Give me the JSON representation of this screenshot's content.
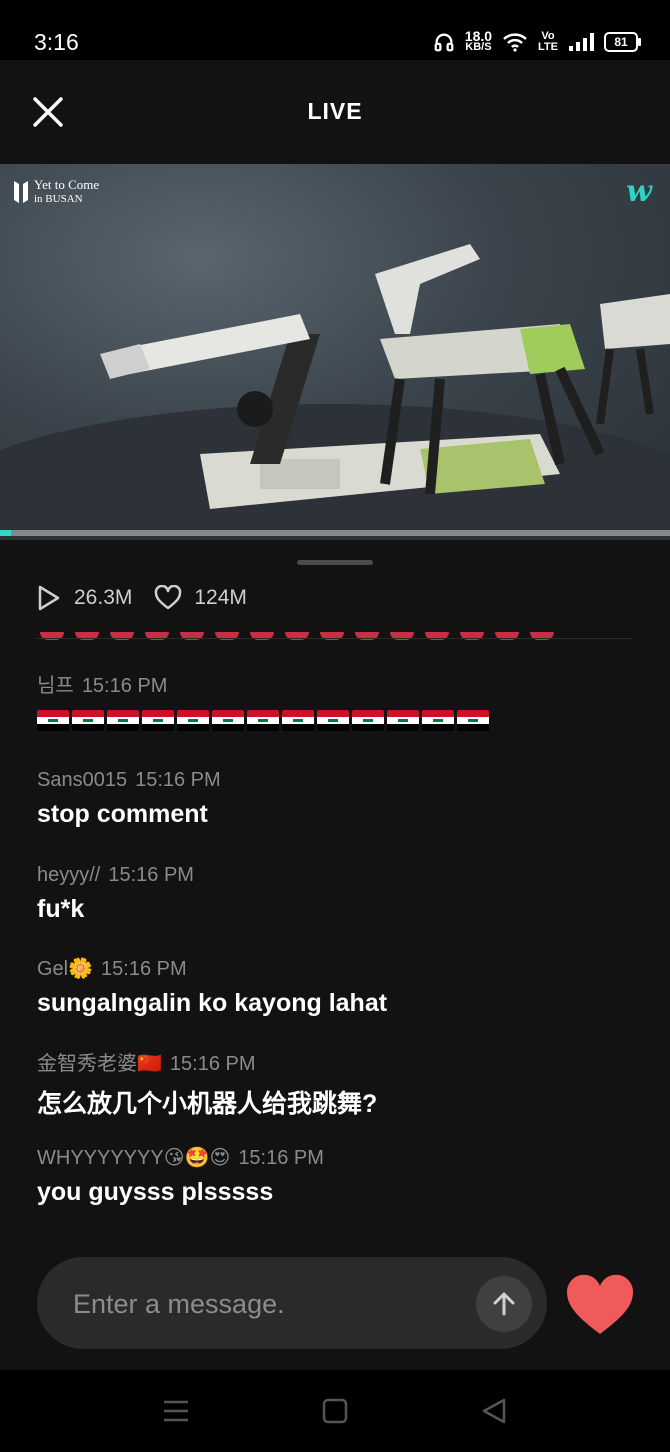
{
  "status_bar": {
    "time": "3:16",
    "net_speed_value": "18.0",
    "net_speed_unit": "KB/S",
    "network_label_top": "Vo",
    "network_label_bottom": "LTE",
    "battery": "81"
  },
  "header": {
    "title": "LIVE"
  },
  "video": {
    "logo_line1": "Yet to Come",
    "logo_line2": "in BUSAN",
    "brand_icon": "w",
    "progress_fraction": 0.017
  },
  "stats": {
    "views": "26.3M",
    "likes": "124M"
  },
  "chat": [
    {
      "user": "님프",
      "time": "15:16 PM",
      "text": "",
      "flag_count": 13
    },
    {
      "user": "Sans0015",
      "time": "15:16 PM",
      "text": "stop comment"
    },
    {
      "user": "heyyy//",
      "time": "15:16 PM",
      "text": "fu*k"
    },
    {
      "user": "Gel🌼",
      "time": "15:16 PM",
      "text": "sungalngalin ko kayong lahat"
    },
    {
      "user": "金智秀老婆🇨🇳",
      "time": "15:16 PM",
      "text": "怎么放几个小机器人给我跳舞?"
    },
    {
      "user": "WHYYYYYYY😘🤩😍",
      "time": "15:16 PM",
      "text": "you guysss plsssss"
    }
  ],
  "composer": {
    "placeholder": "Enter a message."
  },
  "colors": {
    "accent": "#37d5c6",
    "heart": "#f05a5a",
    "background": "#121212"
  },
  "icons": [
    "close-icon",
    "play-icon",
    "heart-outline-icon",
    "send-arrow-icon",
    "heart-icon",
    "menu-icon",
    "home-icon",
    "back-icon"
  ]
}
